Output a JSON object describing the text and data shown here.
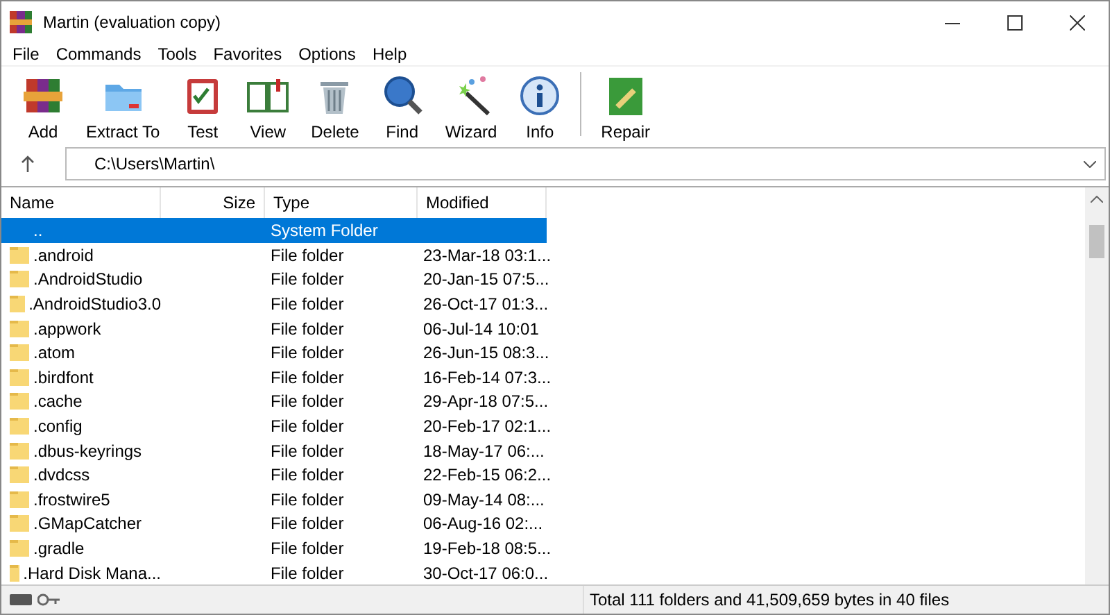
{
  "window": {
    "title": "Martin (evaluation copy)"
  },
  "menu": [
    "File",
    "Commands",
    "Tools",
    "Favorites",
    "Options",
    "Help"
  ],
  "toolbar": [
    {
      "kind": "add",
      "label": "Add"
    },
    {
      "kind": "extract",
      "label": "Extract To"
    },
    {
      "kind": "test",
      "label": "Test"
    },
    {
      "kind": "view",
      "label": "View"
    },
    {
      "kind": "delete",
      "label": "Delete"
    },
    {
      "kind": "find",
      "label": "Find"
    },
    {
      "kind": "wizard",
      "label": "Wizard"
    },
    {
      "kind": "info",
      "label": "Info"
    },
    {
      "kind": "repair",
      "label": "Repair"
    }
  ],
  "address": {
    "value": "C:\\Users\\Martin\\"
  },
  "table": {
    "columns": [
      "Name",
      "Size",
      "Type",
      "Modified"
    ],
    "rows": [
      {
        "name": "..",
        "size": "",
        "type": "System Folder",
        "modified": "",
        "selected": true
      },
      {
        "name": ".android",
        "type": "File folder",
        "modified": "23-Mar-18 03:1...",
        "selected": false
      },
      {
        "name": ".AndroidStudio",
        "type": "File folder",
        "modified": "20-Jan-15 07:5...",
        "selected": false
      },
      {
        "name": ".AndroidStudio3.0",
        "type": "File folder",
        "modified": "26-Oct-17 01:3...",
        "selected": false
      },
      {
        "name": ".appwork",
        "type": "File folder",
        "modified": "06-Jul-14 10:01",
        "selected": false
      },
      {
        "name": ".atom",
        "type": "File folder",
        "modified": "26-Jun-15 08:3...",
        "selected": false
      },
      {
        "name": ".birdfont",
        "type": "File folder",
        "modified": "16-Feb-14 07:3...",
        "selected": false
      },
      {
        "name": ".cache",
        "type": "File folder",
        "modified": "29-Apr-18 07:5...",
        "selected": false
      },
      {
        "name": ".config",
        "type": "File folder",
        "modified": "20-Feb-17 02:1...",
        "selected": false
      },
      {
        "name": ".dbus-keyrings",
        "type": "File folder",
        "modified": "18-May-17 06:...",
        "selected": false
      },
      {
        "name": ".dvdcss",
        "type": "File folder",
        "modified": "22-Feb-15 06:2...",
        "selected": false
      },
      {
        "name": ".frostwire5",
        "type": "File folder",
        "modified": "09-May-14 08:...",
        "selected": false
      },
      {
        "name": ".GMapCatcher",
        "type": "File folder",
        "modified": "06-Aug-16 02:...",
        "selected": false
      },
      {
        "name": ".gradle",
        "type": "File folder",
        "modified": "19-Feb-18 08:5...",
        "selected": false
      },
      {
        "name": ".Hard Disk Mana...",
        "type": "File folder",
        "modified": "30-Oct-17 06:0...",
        "selected": false
      }
    ]
  },
  "status_bar": {
    "text": "Total 111 folders and 41,509,659 bytes in 40 files"
  }
}
